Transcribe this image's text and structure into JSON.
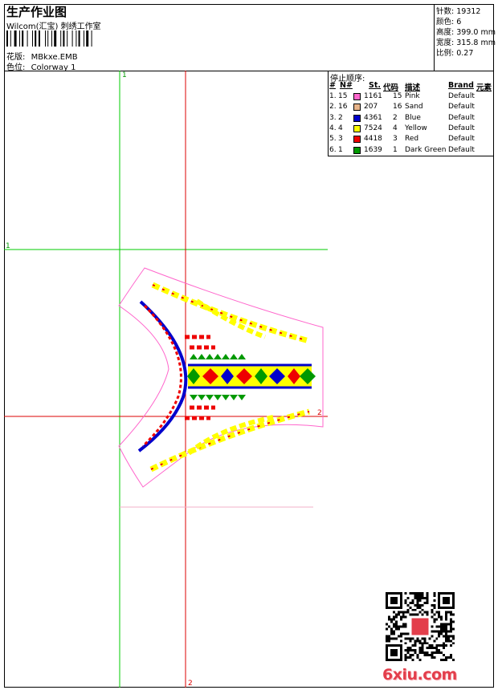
{
  "header": {
    "title": "生产作业图",
    "subtitle": "Wilcom(汇宝) 刺绣工作室",
    "design_label": "花版:",
    "design_value": "MBkxe.EMB",
    "colorway_label": "色位:",
    "colorway_value": "Colorway 1"
  },
  "stats": [
    {
      "label": "针数:",
      "value": "19312"
    },
    {
      "label": "颜色:",
      "value": "6"
    },
    {
      "label": "高度:",
      "value": "399.0 mm"
    },
    {
      "label": "宽度:",
      "value": "315.8 mm"
    },
    {
      "label": "比例:",
      "value": "0.27"
    }
  ],
  "stop_sequence": {
    "title": "停止顺序:",
    "headers": [
      "#",
      "N#",
      "St.",
      "代码",
      "描述",
      "Brand",
      "元素"
    ],
    "rows": [
      {
        "idx": "1.",
        "n": "15",
        "color": "#ff66cc",
        "st": "1161",
        "code": "15",
        "desc": "Pink",
        "brand": "Default"
      },
      {
        "idx": "2.",
        "n": "16",
        "color": "#e8b48a",
        "st": "207",
        "code": "16",
        "desc": "Sand",
        "brand": "Default"
      },
      {
        "idx": "3.",
        "n": "2",
        "color": "#0000cc",
        "st": "4361",
        "code": "2",
        "desc": "Blue",
        "brand": "Default"
      },
      {
        "idx": "4.",
        "n": "4",
        "color": "#ffff00",
        "st": "7524",
        "code": "4",
        "desc": "Yellow",
        "brand": "Default"
      },
      {
        "idx": "5.",
        "n": "3",
        "color": "#ee0000",
        "st": "4418",
        "code": "3",
        "desc": "Red",
        "brand": "Default"
      },
      {
        "idx": "6.",
        "n": "1",
        "color": "#009900",
        "st": "1639",
        "code": "1",
        "desc": "Dark Green",
        "brand": "Default"
      }
    ]
  },
  "axis_labels": {
    "top": "1",
    "left": "1",
    "right": "2",
    "bottom": "2"
  },
  "footer": {
    "logo": "6xiu.com"
  }
}
